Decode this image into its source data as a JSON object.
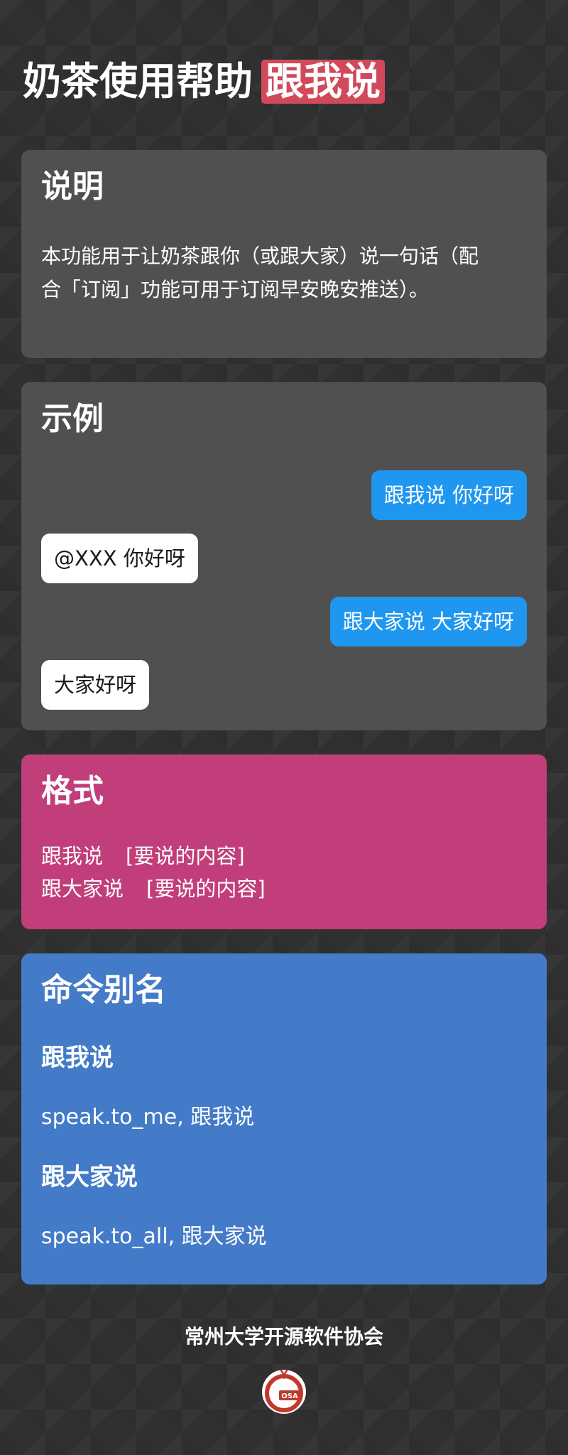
{
  "header": {
    "title": "奶茶使用帮助",
    "tag": "跟我说",
    "tag_color": "#d1495b"
  },
  "description": {
    "heading": "说明",
    "text": "本功能用于让奶茶跟你（或跟大家）说一句话（配合「订阅」功能可用于订阅早安晚安推送）。"
  },
  "example": {
    "heading": "示例",
    "messages": [
      {
        "direction": "out",
        "text": "跟我说 你好呀"
      },
      {
        "direction": "in",
        "text": "@XXX 你好呀"
      },
      {
        "direction": "out",
        "text": "跟大家说 大家好呀"
      },
      {
        "direction": "in",
        "text": "大家好呀"
      }
    ],
    "out_color": "#1f96f0",
    "in_color": "#ffffff"
  },
  "format": {
    "heading": "格式",
    "lines": [
      {
        "command": "跟我说",
        "arg": "[要说的内容]"
      },
      {
        "command": "跟大家说",
        "arg": "[要说的内容]"
      }
    ],
    "color": "#c13e7a"
  },
  "aliases": {
    "heading": "命令别名",
    "items": [
      {
        "name": "跟我说",
        "values": "speak.to_me, 跟我说"
      },
      {
        "name": "跟大家说",
        "values": "speak.to_all, 跟大家说"
      }
    ],
    "color": "#437bc8"
  },
  "footer": {
    "org": "常州大学开源软件协会",
    "logo_text": "OSA",
    "logo_icon": "dragon-logo-icon"
  }
}
